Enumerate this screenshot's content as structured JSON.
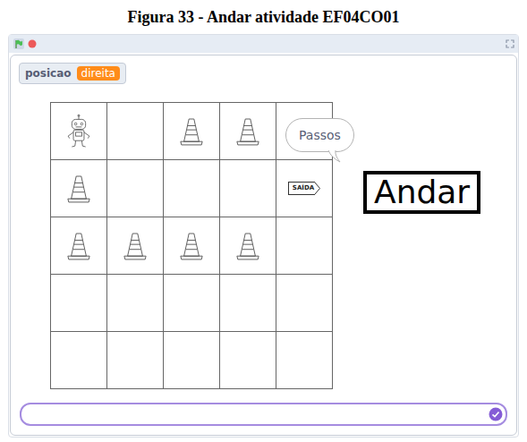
{
  "caption": "Figura 33 - Andar atividade EF04CO01",
  "variable_monitor": {
    "name": "posicao",
    "value": "direita"
  },
  "speech_bubble": {
    "text": "Passos"
  },
  "sign": {
    "text": "Andar"
  },
  "grid": [
    [
      {
        "kind": "robot"
      },
      {
        "kind": "empty"
      },
      {
        "kind": "cone"
      },
      {
        "kind": "cone"
      },
      {
        "kind": "empty"
      }
    ],
    [
      {
        "kind": "cone"
      },
      {
        "kind": "empty"
      },
      {
        "kind": "empty"
      },
      {
        "kind": "empty"
      },
      {
        "kind": "exit",
        "label": "SAÍDA"
      }
    ],
    [
      {
        "kind": "cone"
      },
      {
        "kind": "cone"
      },
      {
        "kind": "cone"
      },
      {
        "kind": "cone"
      },
      {
        "kind": "empty"
      }
    ],
    [
      {
        "kind": "empty"
      },
      {
        "kind": "empty"
      },
      {
        "kind": "empty"
      },
      {
        "kind": "empty"
      },
      {
        "kind": "empty"
      }
    ],
    [
      {
        "kind": "empty"
      },
      {
        "kind": "empty"
      },
      {
        "kind": "empty"
      },
      {
        "kind": "empty"
      },
      {
        "kind": "empty"
      }
    ]
  ],
  "ask_field": {
    "value": ""
  }
}
